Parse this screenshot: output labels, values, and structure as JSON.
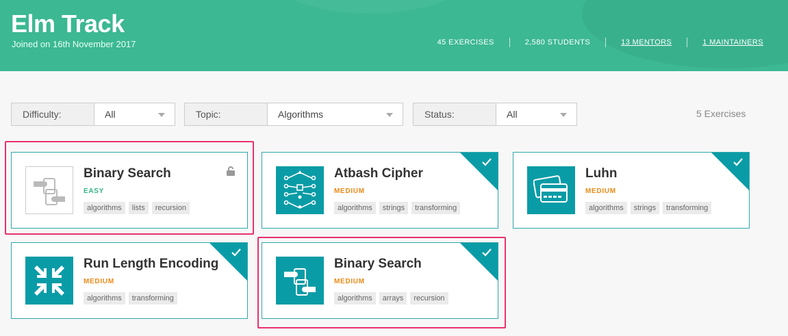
{
  "header": {
    "title": "Elm Track",
    "joined": "Joined on 16th November 2017",
    "stats": {
      "exercises": "45 EXERCISES",
      "students": "2,580 STUDENTS",
      "mentors": "13 MENTORS",
      "maintainers": "1 MAINTAINERS"
    }
  },
  "filters": {
    "difficulty": {
      "label": "Difficulty:",
      "value": "All"
    },
    "topic": {
      "label": "Topic:",
      "value": "Algorithms"
    },
    "status": {
      "label": "Status:",
      "value": "All"
    }
  },
  "exercise_count": "5 Exercises",
  "cards": [
    {
      "name": "Binary Search",
      "difficulty": "EASY",
      "tags": [
        "algorithms",
        "lists",
        "recursion"
      ],
      "icon": "hands-icon",
      "locked": true,
      "completed": false
    },
    {
      "name": "Atbash Cipher",
      "difficulty": "MEDIUM",
      "tags": [
        "algorithms",
        "strings",
        "transforming"
      ],
      "icon": "cipher-icon",
      "locked": false,
      "completed": true
    },
    {
      "name": "Luhn",
      "difficulty": "MEDIUM",
      "tags": [
        "algorithms",
        "strings",
        "transforming"
      ],
      "icon": "credit-card-icon",
      "locked": false,
      "completed": true
    },
    {
      "name": "Run Length Encoding",
      "difficulty": "MEDIUM",
      "tags": [
        "algorithms",
        "transforming"
      ],
      "icon": "compress-arrows-icon",
      "locked": false,
      "completed": true
    },
    {
      "name": "Binary Search",
      "difficulty": "MEDIUM",
      "tags": [
        "algorithms",
        "arrays",
        "recursion"
      ],
      "icon": "hands-icon",
      "locked": false,
      "completed": true
    }
  ],
  "colors": {
    "header": "#3cb892",
    "accent": "#0a9ca6",
    "easy": "#35b584",
    "medium": "#ec8a18",
    "highlight": "#e8326d"
  }
}
